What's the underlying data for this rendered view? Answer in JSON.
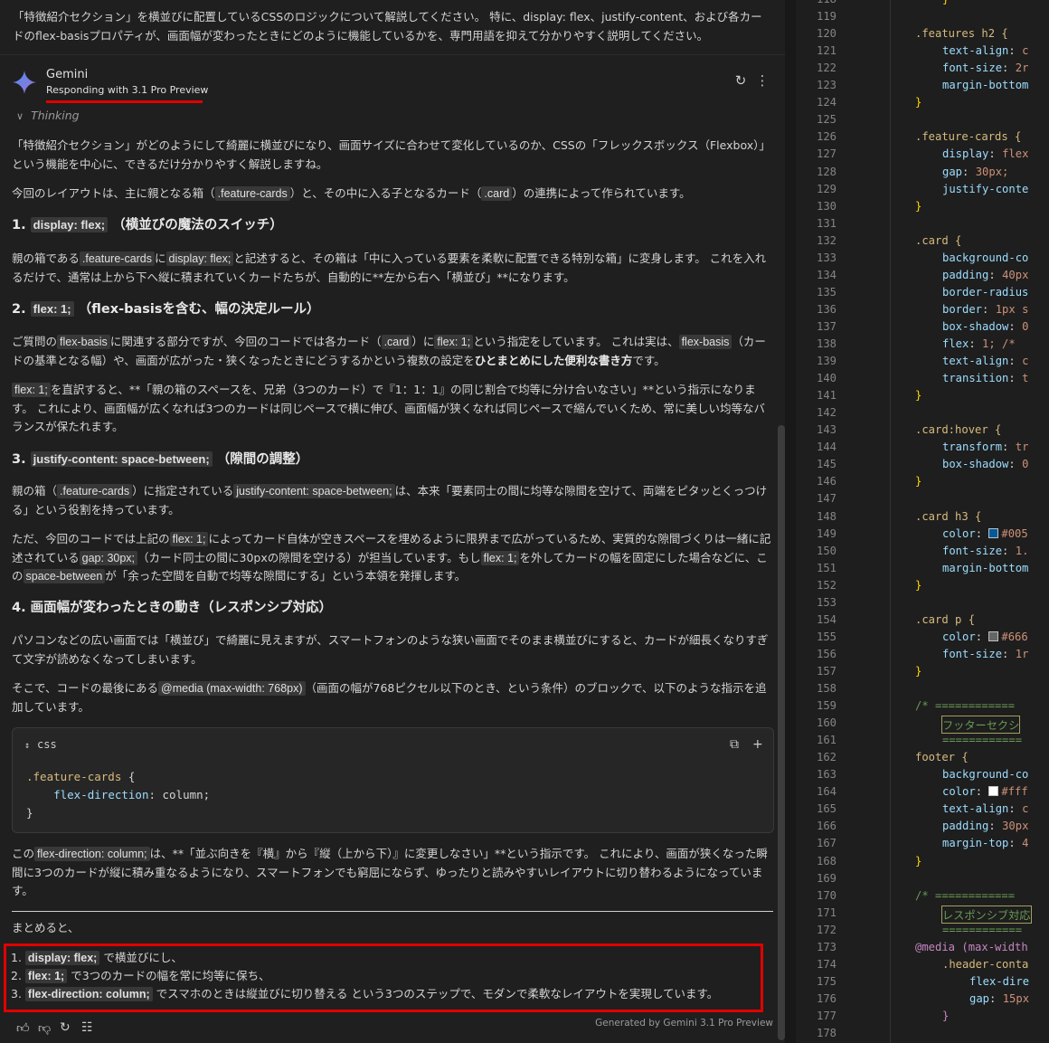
{
  "prompt_text": "「特徴紹介セクション」を横並びに配置しているCSSのロジックについて解説してください。 特に、display: flex、justify-content、および各カードのflex-basisプロパティが、画面幅が変わったときにどのように機能しているかを、専門用語を抑えて分かりやすく説明してください。",
  "assistant": {
    "name": "Gemini",
    "model_label": "Responding with 3.1 Pro Preview",
    "thinking_label": "Thinking",
    "colors": {
      "highlight": "#e00000",
      "star_a": "#4f8df7",
      "star_b": "#9b72cb"
    }
  },
  "response": {
    "intro": "「特徴紹介セクション」がどのようにして綺麗に横並びになり、画面サイズに合わせて変化しているのか、CSSの「フレックスボックス（Flexbox）」という機能を中心に、できるだけ分かりやすく解説しますね。",
    "p0": {
      "a": "今回のレイアウトは、主に親となる箱（",
      "c1": ".feature-cards",
      "b": "）と、その中に入る子となるカード（",
      "c2": ".card",
      "c": "）の連携によって作られています。"
    },
    "h1": {
      "num": "1.",
      "code": "display: flex;",
      "text": "（横並びの魔法のスイッチ）"
    },
    "p1": {
      "a": "親の箱である",
      "c1": ".feature-cards",
      "b": "に",
      "c2": "display: flex;",
      "c": "と記述すると、その箱は「中に入っている要素を柔軟に配置できる特別な箱」に変身します。 これを入れるだけで、通常は上から下へ縦に積まれていくカードたちが、自動的に**左から右へ「横並び」**になります。"
    },
    "h2": {
      "num": "2.",
      "code": "flex: 1;",
      "text": "（flex-basisを含む、幅の決定ルール）"
    },
    "p2": {
      "a": "ご質問の",
      "c1": "flex-basis",
      "b": "に関連する部分ですが、今回のコードでは各カード（",
      "c2": ".card",
      "c": "）に",
      "c3": "flex: 1;",
      "d": "という指定をしています。 これは実は、",
      "c4": "flex-basis",
      "e": "（カードの基準となる幅）や、画面が広がった・狭くなったときにどうするかという複数の設定を",
      "strong": "ひとまとめにした便利な書き方",
      "f": "です。"
    },
    "p3": {
      "c1": "flex: 1;",
      "a": "を直訳すると、**「親の箱のスペースを、兄弟（3つのカード）で『1：1：1』の同じ割合で均等に分け合いなさい」**という指示になります。 これにより、画面幅が広くなれば3つのカードは同じペースで横に伸び、画面幅が狭くなれば同じペースで縮んでいくため、常に美しい均等なバランスが保たれます。"
    },
    "h3": {
      "num": "3.",
      "code": "justify-content: space-between;",
      "text": "（隙間の調整）"
    },
    "p4": {
      "a": "親の箱（",
      "c1": ".feature-cards",
      "b": "）に指定されている",
      "c2": "justify-content: space-between;",
      "c": "は、本来「要素同士の間に均等な隙間を空けて、両端をピタッとくっつける」という役割を持っています。"
    },
    "p5": {
      "a": "ただ、今回のコードでは上記の",
      "c1": "flex: 1;",
      "b": "によってカード自体が空きスペースを埋めるように限界まで広がっているため、実質的な隙間づくりは一緒に記述されている",
      "c2": "gap: 30px;",
      "c": "（カード同士の間に30pxの隙間を空ける）が担当しています。もし",
      "c3": "flex: 1;",
      "d": "を外してカードの幅を固定にした場合などに、この",
      "c4": "space-between",
      "e": "が「余った空間を自動で均等な隙間にする」という本領を発揮します。"
    },
    "h4": {
      "text": "4. 画面幅が変わったときの動き（レスポンシブ対応）"
    },
    "p6": "パソコンなどの広い画面では「横並び」で綺麗に見えますが、スマートフォンのような狭い画面でそのまま横並びにすると、カードが細長くなりすぎて文字が読めなくなってしまいます。",
    "p7": {
      "a": "そこで、コードの最後にある",
      "c1": "@media (max-width: 768px)",
      "b": "（画面の幅が768ピクセル以下のとき、という条件）のブロックで、以下のような指示を追加しています。"
    },
    "code_block": {
      "lang": "css",
      "line1_sel": ".feature-cards",
      "line1_rest": " {",
      "line2_prop": "flex-direction",
      "line2_rest": ": column;",
      "line3": "}"
    },
    "p8": {
      "a": "この",
      "c1": "flex-direction: column;",
      "b": "は、**「並ぶ向きを『横』から『縦（上から下）』に変更しなさい」**という指示です。 これにより、画面が狭くなった瞬間に3つのカードが縦に積み重なるようになり、スマートフォンでも窮屈にならず、ゆったりと読みやすいレイアウトに切り替わるようになっています。"
    },
    "summary_intro": "まとめると、",
    "summary": [
      {
        "num": "1.",
        "code": "display: flex;",
        "text": "で横並びにし、"
      },
      {
        "num": "2.",
        "code": "flex: 1;",
        "text": "で3つのカードの幅を常に均等に保ち、"
      },
      {
        "num": "3.",
        "code": "flex-direction: column;",
        "text": "でスマホのときは縦並びに切り替える という3つのステップで、モダンで柔軟なレイアウトを実現しています。"
      }
    ],
    "generated_by": "Generated by Gemini 3.1 Pro Preview"
  },
  "editor": {
    "line_numbers": [
      "118",
      "119",
      "120",
      "121",
      "122",
      "123",
      "124",
      "125",
      "126",
      "127",
      "128",
      "129",
      "130",
      "131",
      "132",
      "133",
      "134",
      "135",
      "136",
      "137",
      "138",
      "139",
      "140",
      "141",
      "142",
      "143",
      "144",
      "145",
      "146",
      "147",
      "148",
      "149",
      "150",
      "151",
      "152",
      "153",
      "154",
      "155",
      "156",
      "157",
      "158",
      "159",
      "160",
      "161",
      "162",
      "163",
      "164",
      "165",
      "166",
      "167",
      "168",
      "169",
      "170",
      "171",
      "172",
      "173",
      "174",
      "175",
      "176",
      "177",
      "178"
    ],
    "lines": [
      {
        "t": "}",
        "c": "br",
        "i": 1
      },
      {
        "t": "",
        "c": "",
        "i": 0
      },
      {
        "t": ".features h2 {",
        "c": "sel",
        "i": 0
      },
      {
        "t": "text-align: c",
        "c": "prop",
        "i": 1
      },
      {
        "t": "font-size: 2r",
        "c": "prop",
        "i": 1
      },
      {
        "t": "margin-bottom",
        "c": "prop",
        "i": 1
      },
      {
        "t": "}",
        "c": "br",
        "i": 0
      },
      {
        "t": "",
        "c": "",
        "i": 0
      },
      {
        "t": ".feature-cards {",
        "c": "sel",
        "i": 0
      },
      {
        "t": "display: flex",
        "c": "prop",
        "i": 1
      },
      {
        "t": "gap: 30px;",
        "c": "prop",
        "i": 1
      },
      {
        "t": "justify-conte",
        "c": "prop",
        "i": 1
      },
      {
        "t": "}",
        "c": "br",
        "i": 0
      },
      {
        "t": "",
        "c": "",
        "i": 0
      },
      {
        "t": ".card {",
        "c": "sel",
        "i": 0
      },
      {
        "t": "background-co",
        "c": "prop",
        "i": 1
      },
      {
        "t": "padding: 40px",
        "c": "prop",
        "i": 1
      },
      {
        "t": "border-radius",
        "c": "prop",
        "i": 1
      },
      {
        "t": "border: 1px s",
        "c": "prop",
        "i": 1
      },
      {
        "t": "box-shadow: 0",
        "c": "prop",
        "i": 1
      },
      {
        "t": "flex: 1; /* ",
        "c": "prop",
        "i": 1
      },
      {
        "t": "text-align: c",
        "c": "prop",
        "i": 1
      },
      {
        "t": "transition: t",
        "c": "prop",
        "i": 1
      },
      {
        "t": "}",
        "c": "br",
        "i": 0
      },
      {
        "t": "",
        "c": "",
        "i": 0
      },
      {
        "t": ".card:hover {",
        "c": "sel",
        "i": 0
      },
      {
        "t": "transform: tr",
        "c": "prop",
        "i": 1
      },
      {
        "t": "box-shadow: 0",
        "c": "prop",
        "i": 1
      },
      {
        "t": "}",
        "c": "br",
        "i": 0
      },
      {
        "t": "",
        "c": "",
        "i": 0
      },
      {
        "t": ".card h3 {",
        "c": "sel",
        "i": 0
      },
      {
        "t": "color: #005",
        "c": "prop",
        "i": 1,
        "sw": "#005a9c"
      },
      {
        "t": "font-size: 1.",
        "c": "prop",
        "i": 1
      },
      {
        "t": "margin-bottom",
        "c": "prop",
        "i": 1
      },
      {
        "t": "}",
        "c": "br",
        "i": 0
      },
      {
        "t": "",
        "c": "",
        "i": 0
      },
      {
        "t": ".card p {",
        "c": "sel",
        "i": 0
      },
      {
        "t": "color: #666",
        "c": "prop",
        "i": 1,
        "sw": "#666666"
      },
      {
        "t": "font-size: 1r",
        "c": "prop",
        "i": 1
      },
      {
        "t": "}",
        "c": "br",
        "i": 0
      },
      {
        "t": "",
        "c": "",
        "i": 0
      },
      {
        "t": "/* ============",
        "c": "com",
        "i": 0
      },
      {
        "t": "フッターセクシ",
        "c": "com",
        "i": 1,
        "box": true
      },
      {
        "t": "============",
        "c": "com",
        "i": 1
      },
      {
        "t": "footer {",
        "c": "sel",
        "i": 0
      },
      {
        "t": "background-co",
        "c": "prop",
        "i": 1
      },
      {
        "t": "color: #fff",
        "c": "prop",
        "i": 1,
        "sw": "#ffffff"
      },
      {
        "t": "text-align: c",
        "c": "prop",
        "i": 1
      },
      {
        "t": "padding: 30px",
        "c": "prop",
        "i": 1
      },
      {
        "t": "margin-top: 4",
        "c": "prop",
        "i": 1
      },
      {
        "t": "}",
        "c": "br",
        "i": 0
      },
      {
        "t": "",
        "c": "",
        "i": 0
      },
      {
        "t": "/* ============",
        "c": "com",
        "i": 0
      },
      {
        "t": "レスポンシブ対応",
        "c": "com",
        "i": 1,
        "box": true
      },
      {
        "t": "============",
        "c": "com",
        "i": 1
      },
      {
        "t": "@media (max-width",
        "c": "at",
        "i": 0
      },
      {
        "t": ".header-conta",
        "c": "sel",
        "i": 1
      },
      {
        "t": "flex-dire",
        "c": "prop",
        "i": 2
      },
      {
        "t": "gap: 15px",
        "c": "prop",
        "i": 2
      },
      {
        "t": "}",
        "c": "at",
        "i": 1
      },
      {
        "t": "",
        "c": "",
        "i": 0
      }
    ]
  }
}
